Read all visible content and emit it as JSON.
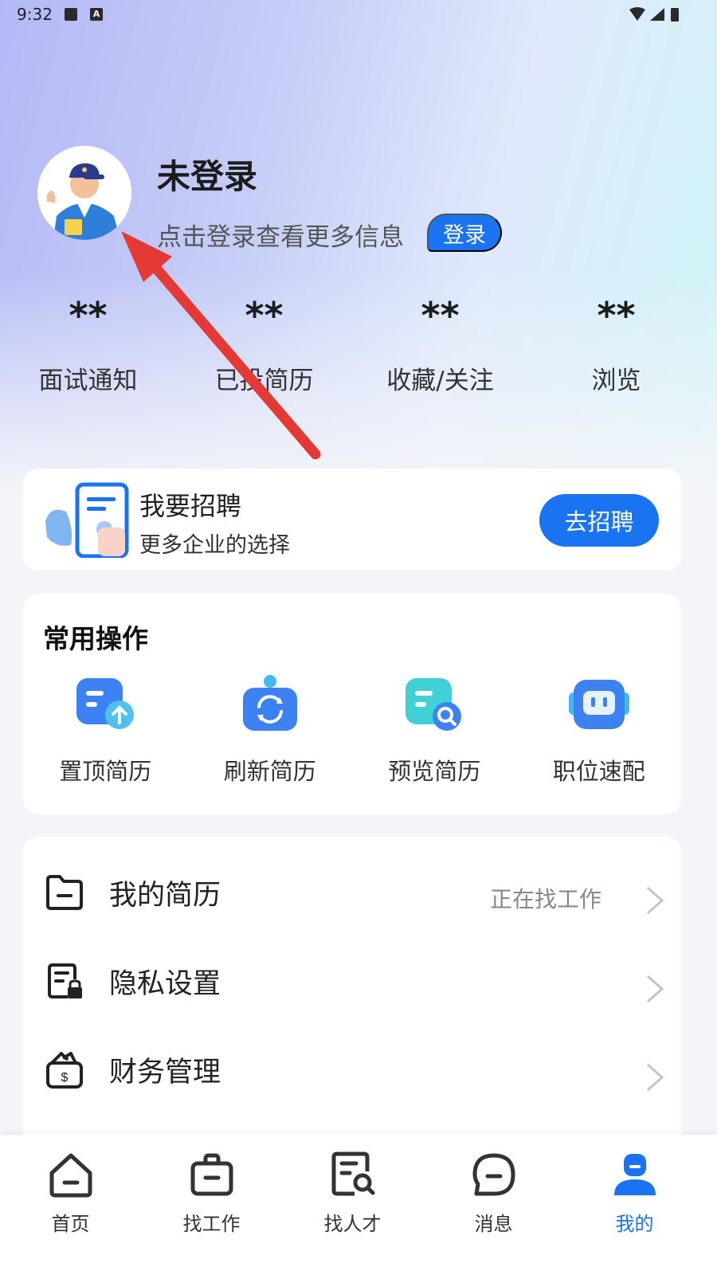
{
  "status_bar": {
    "time": "9:32",
    "font_icon_letter": "A"
  },
  "profile": {
    "name": "未登录",
    "subtitle": "点击登录查看更多信息",
    "login_label": "登录"
  },
  "stats": [
    {
      "value": "**",
      "label": "面试通知"
    },
    {
      "value": "**",
      "label": "已投简历"
    },
    {
      "value": "**",
      "label": "收藏/关注"
    },
    {
      "value": "**",
      "label": "浏览"
    }
  ],
  "recruit": {
    "title": "我要招聘",
    "subtitle": "更多企业的选择",
    "button_label": "去招聘"
  },
  "ops": {
    "title": "常用操作",
    "items": [
      {
        "label": "置顶简历",
        "icon": "resume-top-icon"
      },
      {
        "label": "刷新简历",
        "icon": "refresh-resume-icon"
      },
      {
        "label": "预览简历",
        "icon": "preview-resume-icon"
      },
      {
        "label": "职位速配",
        "icon": "job-match-icon"
      }
    ]
  },
  "menu": [
    {
      "label": "我的简历",
      "value": "正在找工作",
      "icon": "folder-icon"
    },
    {
      "label": "隐私设置",
      "value": "",
      "icon": "privacy-lock-icon"
    },
    {
      "label": "财务管理",
      "value": "",
      "icon": "wallet-icon"
    }
  ],
  "nav": [
    {
      "label": "首页",
      "icon": "home-icon"
    },
    {
      "label": "找工作",
      "icon": "briefcase-icon"
    },
    {
      "label": "找人才",
      "icon": "talent-search-icon"
    },
    {
      "label": "消息",
      "icon": "message-icon"
    },
    {
      "label": "我的",
      "icon": "profile-icon",
      "active": true
    }
  ],
  "colors": {
    "accent": "#1a73f0",
    "annotation_arrow": "#e53935"
  }
}
